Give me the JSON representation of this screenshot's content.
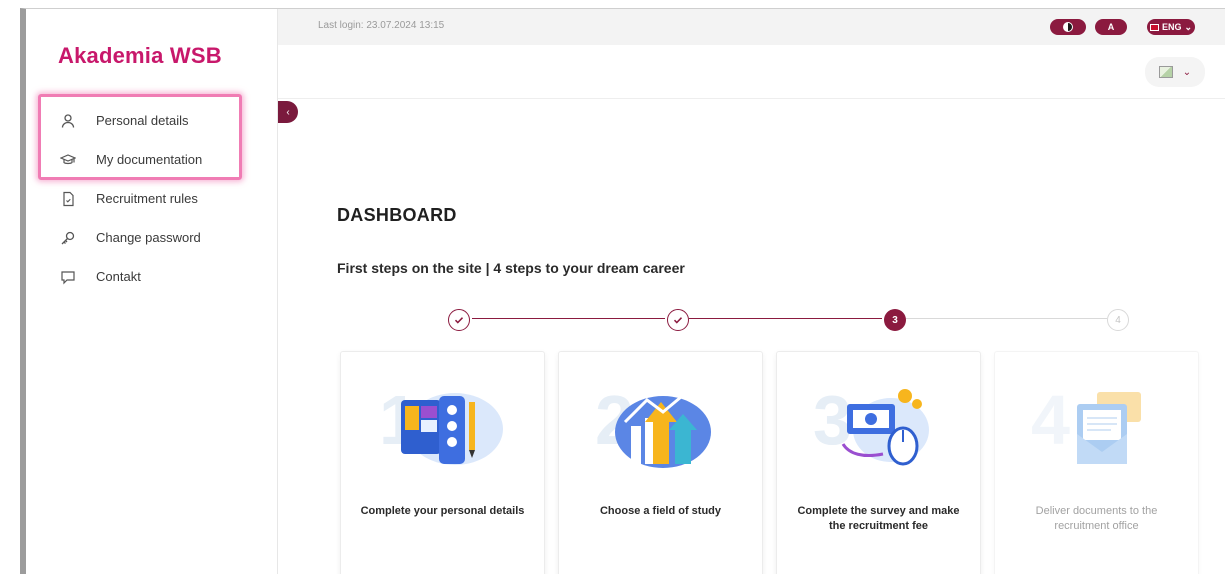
{
  "brand": {
    "name": "Akademia WSB"
  },
  "topbar": {
    "last_login": "Last login: 23.07.2024 13:15",
    "contrast_label": "",
    "font_label": "A",
    "lang_label": "ENG"
  },
  "sidebar": {
    "collapse_label": "‹",
    "items": [
      {
        "label": "Personal details",
        "icon": "user-icon"
      },
      {
        "label": "My documentation",
        "icon": "graduation-cap-icon"
      },
      {
        "label": "Recruitment rules",
        "icon": "document-icon"
      },
      {
        "label": "Change password",
        "icon": "key-icon"
      },
      {
        "label": "Contakt",
        "icon": "chat-bubble-icon"
      }
    ]
  },
  "main": {
    "title": "DASHBOARD",
    "subtitle": "First steps on the site | 4 steps to your dream career",
    "steps": [
      {
        "status": "done",
        "label": ""
      },
      {
        "status": "done",
        "label": ""
      },
      {
        "status": "active",
        "label": "3"
      },
      {
        "status": "todo",
        "label": "4"
      }
    ],
    "cards": [
      {
        "number": "1",
        "label": "Complete your personal details"
      },
      {
        "number": "2",
        "label": "Choose a field of study"
      },
      {
        "number": "3",
        "label": "Complete the survey and make the recruitment fee"
      },
      {
        "number": "4",
        "label": "Deliver documents to the recruitment office"
      }
    ]
  },
  "colors": {
    "brand": "#c8186b",
    "accent": "#8b1a3f",
    "highlight": "#f07cb4"
  }
}
